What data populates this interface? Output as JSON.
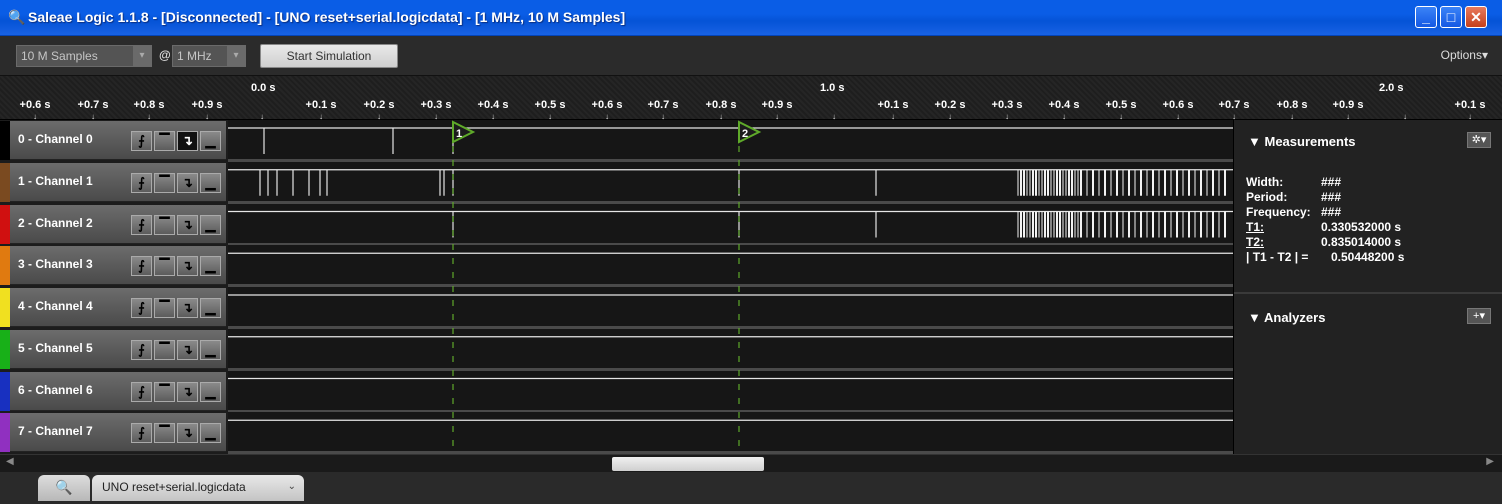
{
  "window": {
    "title": "Saleae Logic 1.1.8 - [Disconnected] - [UNO reset+serial.logicdata] - [1 MHz, 10 M Samples]",
    "buttons": {
      "minimize": "_",
      "maximize": "□",
      "close": "✕"
    }
  },
  "toolbar": {
    "samples_value": "10 M Samples",
    "at": "@",
    "rate_value": "1 MHz",
    "start_button": "Start Simulation",
    "options_label": "Options▾"
  },
  "ruler": {
    "major": [
      {
        "label": "0.0 s"
      },
      {
        "label": "1.0 s"
      },
      {
        "label": "2.0 s"
      }
    ],
    "minor_labels": [
      "+0.6 s",
      "+0.7 s",
      "+0.8 s",
      "+0.9 s",
      "+0.1 s",
      "+0.2 s",
      "+0.3 s",
      "+0.4 s",
      "+0.5 s",
      "+0.6 s",
      "+0.7 s",
      "+0.8 s",
      "+0.9 s",
      "+0.1 s",
      "+0.2 s",
      "+0.3 s",
      "+0.4 s",
      "+0.5 s",
      "+0.6 s",
      "+0.7 s",
      "+0.8 s",
      "+0.9 s",
      "+0.1 s"
    ]
  },
  "channels": [
    {
      "name": "0 - Channel 0",
      "color": "#000000"
    },
    {
      "name": "1 - Channel 1",
      "color": "#7a4a20"
    },
    {
      "name": "2 - Channel 2",
      "color": "#d01010"
    },
    {
      "name": "3 - Channel 3",
      "color": "#e07a10"
    },
    {
      "name": "4 - Channel 4",
      "color": "#f0e020"
    },
    {
      "name": "5 - Channel 5",
      "color": "#18b018"
    },
    {
      "name": "6 - Channel 6",
      "color": "#1830c0"
    },
    {
      "name": "7 - Channel 7",
      "color": "#9030c0"
    }
  ],
  "markers": [
    {
      "label": "1"
    },
    {
      "label": "2"
    }
  ],
  "measurements": {
    "title": "Measurements",
    "rows": [
      {
        "label": "Width:",
        "value": "###"
      },
      {
        "label": "Period:",
        "value": "###"
      },
      {
        "label": "Frequency:",
        "value": "###"
      },
      {
        "label": "T1:",
        "value": "0.330532000 s"
      },
      {
        "label": "T2:",
        "value": "0.835014000 s"
      },
      {
        "label": "| T1 - T2 | =",
        "value": "0.50448200 s"
      }
    ]
  },
  "analyzers": {
    "title": "Analyzers",
    "add_button": "+▾"
  },
  "tabs": {
    "document": "UNO reset+serial.logicdata"
  },
  "colors": {
    "marker": "#5faa2a",
    "titlebar": "#0a5de6"
  }
}
